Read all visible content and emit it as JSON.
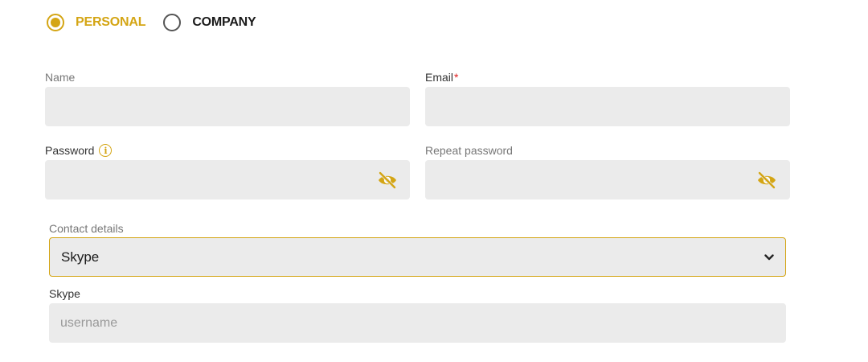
{
  "account_type": {
    "options": [
      {
        "label": "PERSONAL",
        "selected": true
      },
      {
        "label": "COMPANY",
        "selected": false
      }
    ]
  },
  "form": {
    "name": {
      "label": "Name",
      "value": ""
    },
    "email": {
      "label": "Email",
      "required_mark": "*",
      "value": ""
    },
    "password": {
      "label": "Password",
      "info_icon": "info-icon",
      "value": ""
    },
    "repeat_password": {
      "label": "Repeat password",
      "value": ""
    },
    "contact_details": {
      "label": "Contact details",
      "selected": "Skype"
    },
    "skype": {
      "label": "Skype",
      "placeholder": "username",
      "value": ""
    }
  },
  "icons": {
    "password_toggle": "eye-off-icon",
    "select_arrow": "chevron-down-icon"
  },
  "colors": {
    "accent": "#d4a514",
    "field_background": "#ebebeb",
    "required": "#e02020"
  }
}
